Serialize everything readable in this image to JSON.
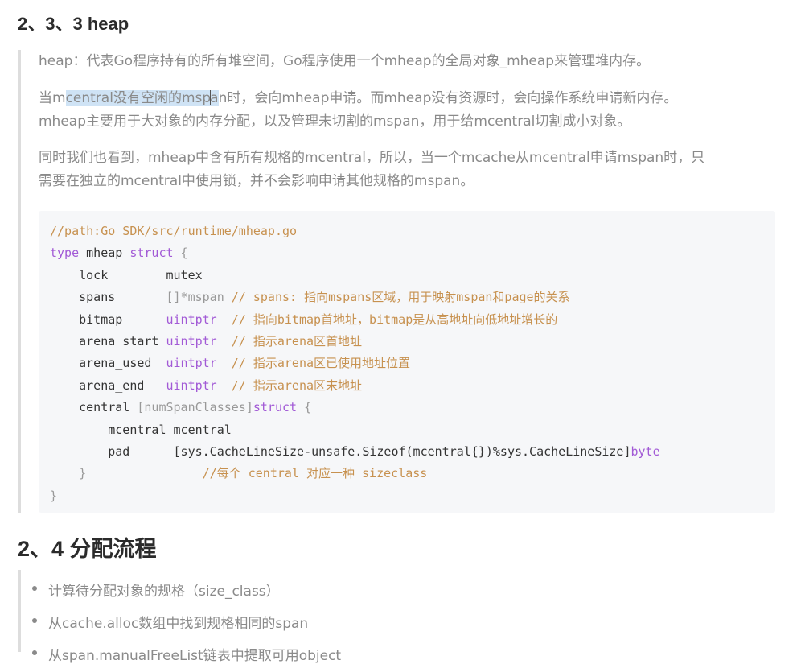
{
  "section1": {
    "title": "2、3、3 heap",
    "para1": "heap：代表Go程序持有的所有堆空间，Go程序使用一个mheap的全局对象_mheap来管理堆内存。",
    "para2": {
      "before": "当m",
      "selected_a": "central没有空闲的msp",
      "selected_b": "a",
      "after": "n时，会向mheap申请。而mheap没有资源时，会向操作系统申请新内存。",
      "line2": "mheap主要用于大对象的内存分配，以及管理未切割的mspan，用于给mcentral切割成小对象。"
    },
    "para3": {
      "line1": "同时我们也看到，mheap中含有所有规格的mcentral，所以，当一个mcache从mcentral申请mspan时，只",
      "line2": "需要在独立的mcentral中使用锁，并不会影响申请其他规格的mspan。"
    }
  },
  "code": {
    "l1": "//path:Go SDK/src/runtime/mheap.go",
    "l2_kw1": "type",
    "l2_name": " mheap ",
    "l2_kw2": "struct",
    "l2_brace": " {",
    "l3_field": "    lock        ",
    "l3_type": "mutex",
    "l4_field": "    spans       ",
    "l4_type": "[]*mspan",
    "l4_comment": " // spans: 指向mspans区域，用于映射mspan和page的关系",
    "l5_field": "    bitmap      ",
    "l5_type": "uintptr",
    "l5_comment": "  // 指向bitmap首地址，bitmap是从高地址向低地址增长的",
    "l6_field": "    arena_start ",
    "l6_type": "uintptr",
    "l6_comment": "  // 指示arena区首地址",
    "l7_field": "    arena_used  ",
    "l7_type": "uintptr",
    "l7_comment": "  // 指示arena区已使用地址位置",
    "l8_field": "    arena_end   ",
    "l8_type": "uintptr",
    "l8_comment": "  // 指示arena区末地址",
    "l9_field": "    central ",
    "l9_mid": "[numSpanClasses]",
    "l9_kw": "struct",
    "l9_brace": " {",
    "l10": "        mcentral mcentral",
    "l11_field": "        pad      ",
    "l11_expr": "[sys.CacheLineSize-unsafe.Sizeof(mcentral{})%sys.CacheLineSize]",
    "l11_type": "byte",
    "l12_brace": "    }",
    "l12_comment": "                //每个 central 对应一种 sizeclass",
    "l13": "}"
  },
  "section2": {
    "title": "2、4 分配流程",
    "items": [
      "计算待分配对象的规格（size_class）",
      "从cache.alloc数组中找到规格相同的span",
      "从span.manualFreeList链表中提取可用object"
    ]
  }
}
